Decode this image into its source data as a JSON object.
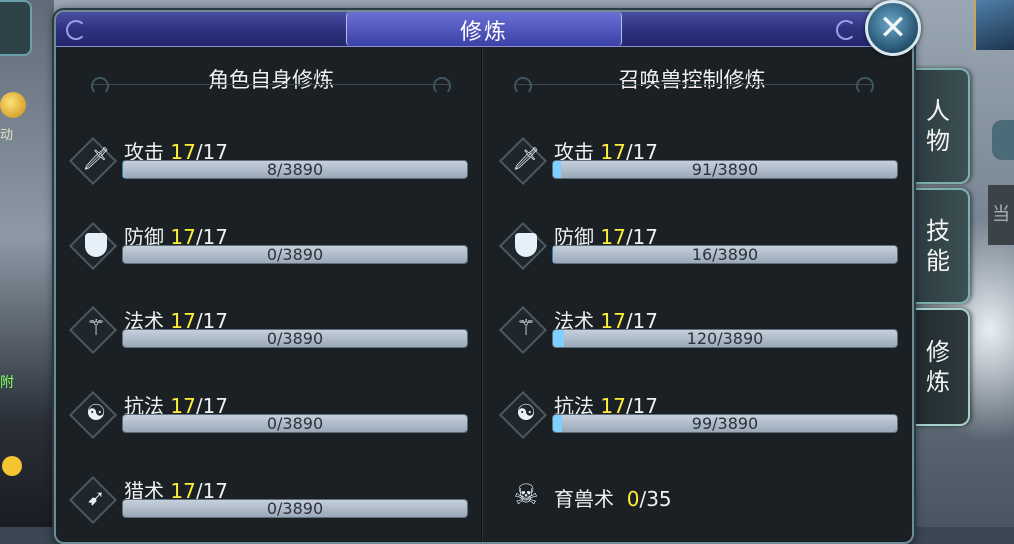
{
  "window": {
    "title": "修炼"
  },
  "left_column": {
    "heading": "角色自身修炼",
    "rows": [
      {
        "name": "攻击",
        "level": "17",
        "max": "/17",
        "exp": "8/3890",
        "fill": 0.002,
        "icon": "sword-icon"
      },
      {
        "name": "防御",
        "level": "17",
        "max": "/17",
        "exp": "0/3890",
        "fill": 0.0,
        "icon": "shield-icon"
      },
      {
        "name": "法术",
        "level": "17",
        "max": "/17",
        "exp": "0/3890",
        "fill": 0.0,
        "icon": "staff-icon"
      },
      {
        "name": "抗法",
        "level": "17",
        "max": "/17",
        "exp": "0/3890",
        "fill": 0.0,
        "icon": "yinyang-icon"
      },
      {
        "name": "猎术",
        "level": "17",
        "max": "/17",
        "exp": "0/3890",
        "fill": 0.0,
        "icon": "bow-icon"
      }
    ]
  },
  "right_column": {
    "heading": "召唤兽控制修炼",
    "rows": [
      {
        "name": "攻击",
        "level": "17",
        "max": "/17",
        "exp": "91/3890",
        "fill": 0.023,
        "icon": "sword-icon"
      },
      {
        "name": "防御",
        "level": "17",
        "max": "/17",
        "exp": "16/3890",
        "fill": 0.004,
        "icon": "shield-icon"
      },
      {
        "name": "法术",
        "level": "17",
        "max": "/17",
        "exp": "120/3890",
        "fill": 0.031,
        "icon": "staff-icon"
      },
      {
        "name": "抗法",
        "level": "17",
        "max": "/17",
        "exp": "99/3890",
        "fill": 0.025,
        "icon": "yinyang-icon"
      }
    ],
    "beast": {
      "name": "育兽术",
      "level": "0",
      "max": "/35",
      "icon": "skull-icon"
    }
  },
  "side_tabs": [
    {
      "label_1": "人",
      "label_2": "物",
      "active": false
    },
    {
      "label_1": "技",
      "label_2": "能",
      "active": false
    },
    {
      "label_1": "修",
      "label_2": "炼",
      "active": true
    }
  ],
  "background": {
    "left_text": "动",
    "left_green": "附",
    "right_char": "当"
  },
  "colors": {
    "title_bar": "#2e3280",
    "level_highlight": "#ffef3a",
    "panel_bg": "#1a2024"
  }
}
